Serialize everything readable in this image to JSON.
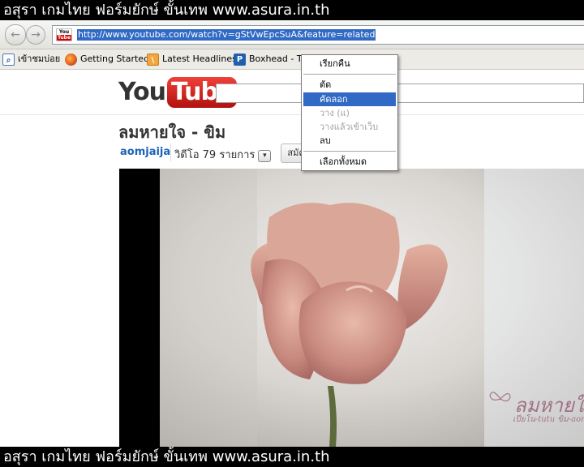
{
  "banner": {
    "text": "อสุรา เกมไทย ฟอร์มยักษ์ ขั้นเทพ www.asura.in.th"
  },
  "browser": {
    "back_glyph": "←",
    "forward_glyph": "→",
    "url": "http://www.youtube.com/watch?v=gStVwEpcSuA&feature=related",
    "favicon": {
      "top": "You",
      "bottom": "Tube"
    },
    "bookmarks": [
      {
        "label": "เข้าชมบ่อย",
        "icon": "search-icon"
      },
      {
        "label": "Getting Started",
        "icon": "firefox-icon"
      },
      {
        "label": "Latest Headlines",
        "icon": "rss-icon"
      },
      {
        "label": "Boxhead - Th",
        "icon": "p-icon"
      }
    ]
  },
  "youtube": {
    "logo_you": "You",
    "logo_tube": "Tube",
    "video_title": "ลมหายใจ - ขิม",
    "channel": "aomjaija",
    "videos_label": "วิดีโอ 79 รายการ",
    "dropdown_glyph": "▾",
    "subscribe_label": "สมัครรับข้อมูล",
    "watermark_main": "ลมหายใจ",
    "watermark_sub": "เปียโน-tutu ขิม-aom"
  },
  "context_menu": {
    "items": [
      {
        "label": "เรียกคืน",
        "state": "normal"
      },
      {
        "label": "ตัด",
        "state": "normal"
      },
      {
        "label": "คัดลอก",
        "state": "highlighted"
      },
      {
        "label": "วาง (แ)",
        "state": "disabled"
      },
      {
        "label": "วางแล้วเข้าเว็บ",
        "state": "disabled"
      },
      {
        "label": "ลบ",
        "state": "normal"
      },
      {
        "label": "เลือกทั้งหมด",
        "state": "normal"
      }
    ]
  },
  "colors": {
    "selection": "#316ac5",
    "channel_link": "#1c62b9",
    "youtube_red": "#d10000"
  }
}
